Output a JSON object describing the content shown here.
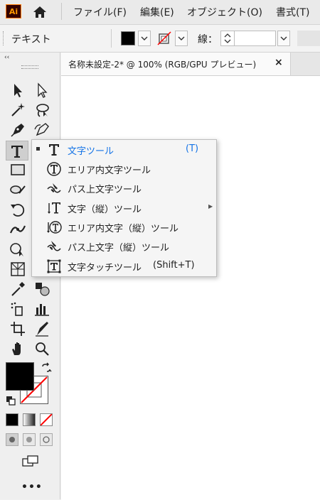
{
  "app": {
    "logo_text": "Ai"
  },
  "menubar": {
    "items": [
      "ファイル(F)",
      "編集(E)",
      "オブジェクト(O)",
      "書式(T)"
    ]
  },
  "control_bar": {
    "label": "テキスト",
    "stroke_label": "線："
  },
  "panel": {
    "collapse_label": "‹‹",
    "more_label": "•••"
  },
  "document_tab": {
    "title": "名称未設定-2* @ 100% (RGB/GPU プレビュー)",
    "close_label": "×"
  },
  "flyout": {
    "items": [
      {
        "label": "文字ツール",
        "shortcut": "(T)",
        "icon": "type-tool-icon",
        "selected": true
      },
      {
        "label": "エリア内文字ツール",
        "shortcut": "",
        "icon": "area-type-tool-icon",
        "selected": false
      },
      {
        "label": "パス上文字ツール",
        "shortcut": "",
        "icon": "type-on-path-tool-icon",
        "selected": false
      },
      {
        "label": "文字（縦）ツール",
        "shortcut": "",
        "icon": "vertical-type-tool-icon",
        "selected": false
      },
      {
        "label": "エリア内文字（縦）ツール",
        "shortcut": "",
        "icon": "vertical-area-type-tool-icon",
        "selected": false
      },
      {
        "label": "パス上文字（縦）ツール",
        "shortcut": "",
        "icon": "vertical-type-on-path-tool-icon",
        "selected": false
      },
      {
        "label": "文字タッチツール",
        "shortcut": "(Shift+T)",
        "icon": "touch-type-tool-icon",
        "selected": false
      }
    ]
  },
  "colors": {
    "accent": "#1473e6",
    "fill": "#000000",
    "stroke_none": "#ff0000",
    "logo_bg": "#330000",
    "logo_text": "#ff9a00"
  }
}
